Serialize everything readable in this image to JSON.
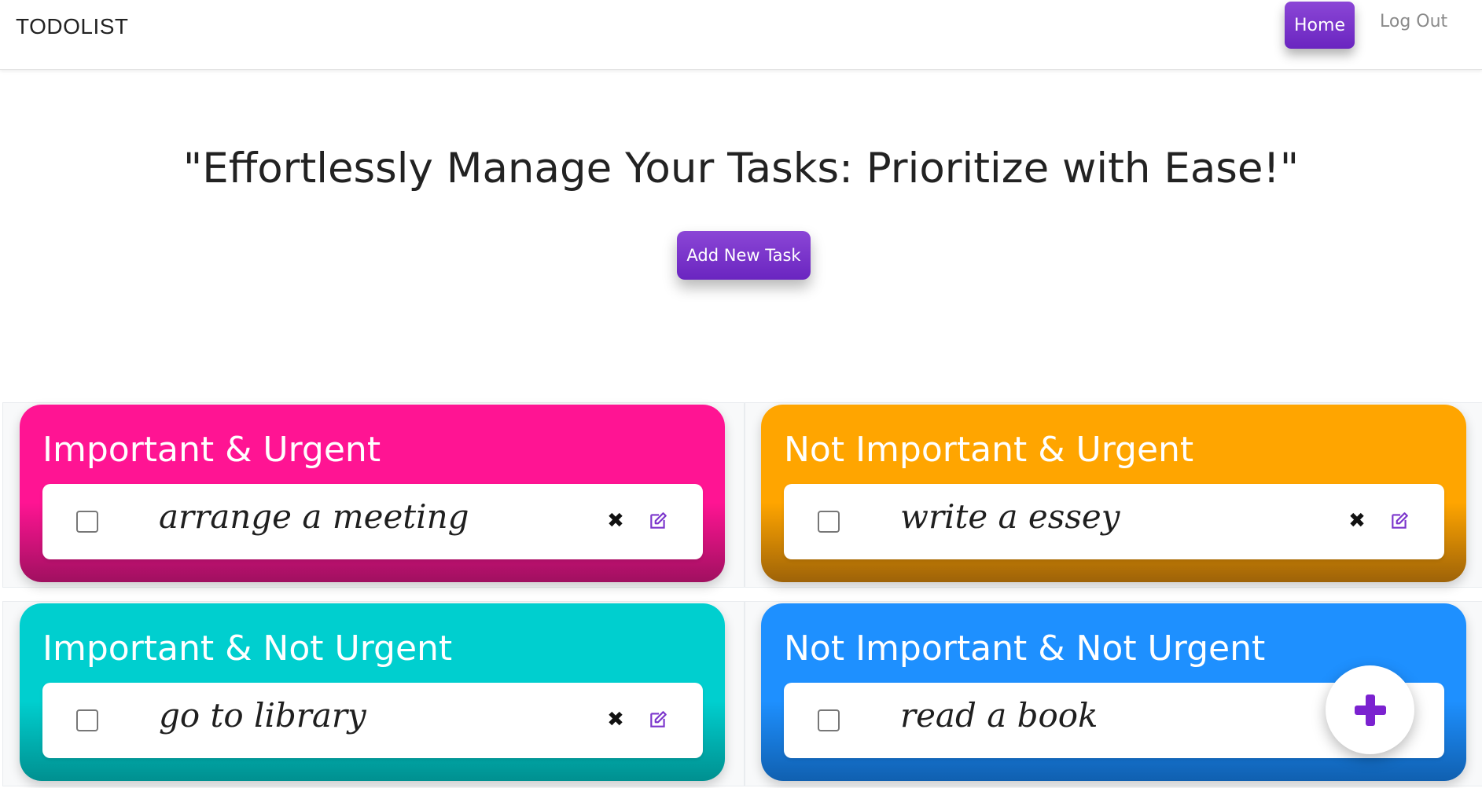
{
  "navbar": {
    "brand": "TODOLIST",
    "home_label": "Home",
    "logout_label": "Log Out"
  },
  "hero": {
    "title": "\"Effortlessly Manage Your Tasks: Prioritize with Ease!\"",
    "add_task_label": "Add New Task"
  },
  "quadrants": [
    {
      "title": "Important & Urgent",
      "color": "#ff1493",
      "tasks": [
        {
          "text": "arrange a meeting",
          "checked": false
        }
      ]
    },
    {
      "title": "Not Important & Urgent",
      "color": "#ffa500",
      "tasks": [
        {
          "text": "write a essey",
          "checked": false
        }
      ]
    },
    {
      "title": "Important & Not Urgent",
      "color": "#00cfcf",
      "tasks": [
        {
          "text": "go to library",
          "checked": false
        }
      ]
    },
    {
      "title": "Not Important & Not Urgent",
      "color": "#1e90ff",
      "tasks": [
        {
          "text": "read a book",
          "checked": false
        }
      ]
    }
  ],
  "icons": {
    "delete": "close-icon",
    "edit": "edit-icon",
    "fab": "plus-icon"
  },
  "colors": {
    "accent": "#7b35cc"
  }
}
